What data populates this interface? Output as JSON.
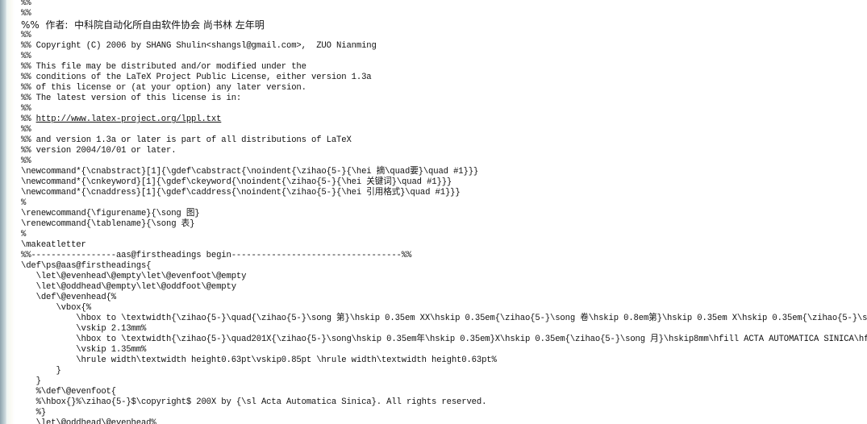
{
  "document": {
    "type": "latex-class-source",
    "lines": [
      {
        "text": "%%"
      },
      {
        "text": "%%"
      },
      {
        "text": "%%  作者:  中科院自动化所自由软件协会 尚书林 左年明",
        "cjk": true
      },
      {
        "text": "%%"
      },
      {
        "text": "%% Copyright (C) 2006 by SHANG Shulin<shangsl@gmail.com>,  ZUO Nianming"
      },
      {
        "text": "%%"
      },
      {
        "text": "%% This file may be distributed and/or modified under the"
      },
      {
        "text": "%% conditions of the LaTeX Project Public License, either version 1.3a"
      },
      {
        "text": "%% of this license or (at your option) any later version."
      },
      {
        "text": "%% The latest version of this license is in:"
      },
      {
        "text": "%%"
      },
      {
        "prefix": "%% ",
        "link": "http://www.latex-project.org/lppl.txt"
      },
      {
        "text": "%%"
      },
      {
        "text": "%% and version 1.3a or later is part of all distributions of LaTeX"
      },
      {
        "text": "%% version 2004/10/01 or later."
      },
      {
        "text": "%%"
      },
      {
        "text": "\\newcommand*{\\cnabstract}[1]{\\gdef\\cabstract{\\noindent{\\zihao{5-}{\\hei 摘\\quad要}\\quad #1}}}"
      },
      {
        "text": "\\newcommand*{\\cnkeyword}[1]{\\gdef\\ckeyword{\\noindent{\\zihao{5-}{\\hei 关键词}\\quad #1}}}"
      },
      {
        "text": "\\newcommand*{\\cnaddress}[1]{\\gdef\\caddress{\\noindent{\\zihao{5-}{\\hei 引用格式}\\quad #1}}}"
      },
      {
        "text": "%"
      },
      {
        "text": "\\renewcommand{\\figurename}{\\song 图}"
      },
      {
        "text": "\\renewcommand{\\tablename}{\\song 表}"
      },
      {
        "text": "%"
      },
      {
        "text": "\\makeatletter"
      },
      {
        "text": "%%-----------------aas@firstheadings begin----------------------------------%%"
      },
      {
        "text": "\\def\\ps@aas@firstheadings{"
      },
      {
        "text": "   \\let\\@evenhead\\@empty\\let\\@evenfoot\\@empty"
      },
      {
        "text": "   \\let\\@oddhead\\@empty\\let\\@oddfoot\\@empty"
      },
      {
        "text": "   \\def\\@evenhead{%"
      },
      {
        "text": "       \\vbox{%"
      },
      {
        "text": "           \\hbox to \\textwidth{\\zihao{5-}\\quad{\\zihao{5-}\\song 第}\\hskip 0.35em XX\\hskip 0.35em{\\zihao{5-}\\song 卷\\hskip 0.8em第}\\hskip 0.35em X\\hskip 0.35em{\\zihao{5-}\\song 期}"
      },
      {
        "text": "           \\vskip 2.13mm%"
      },
      {
        "text": "           \\hbox to \\textwidth{\\zihao{5-}\\quad201X{\\zihao{5-}\\song\\hskip 0.35em年\\hskip 0.35em}X\\hskip 0.35em{\\zihao{5-}\\song 月}\\hskip8mm\\hfill ACTA AUTOMATICA SINICA\\hfill M"
      },
      {
        "text": "           \\vskip 1.35mm%"
      },
      {
        "text": "           \\hrule width\\textwidth height0.63pt\\vskip0.85pt \\hrule width\\textwidth height0.63pt%"
      },
      {
        "text": "       }"
      },
      {
        "text": "   }"
      },
      {
        "text": "   %\\def\\@evenfoot{"
      },
      {
        "text": "   %\\hbox{}%\\zihao{5-}$\\copyright$ 200X by {\\sl Acta Automatica Sinica}. All rights reserved."
      },
      {
        "text": "   %}"
      },
      {
        "text": "   \\let\\@oddhead\\@evenhead%"
      }
    ]
  }
}
